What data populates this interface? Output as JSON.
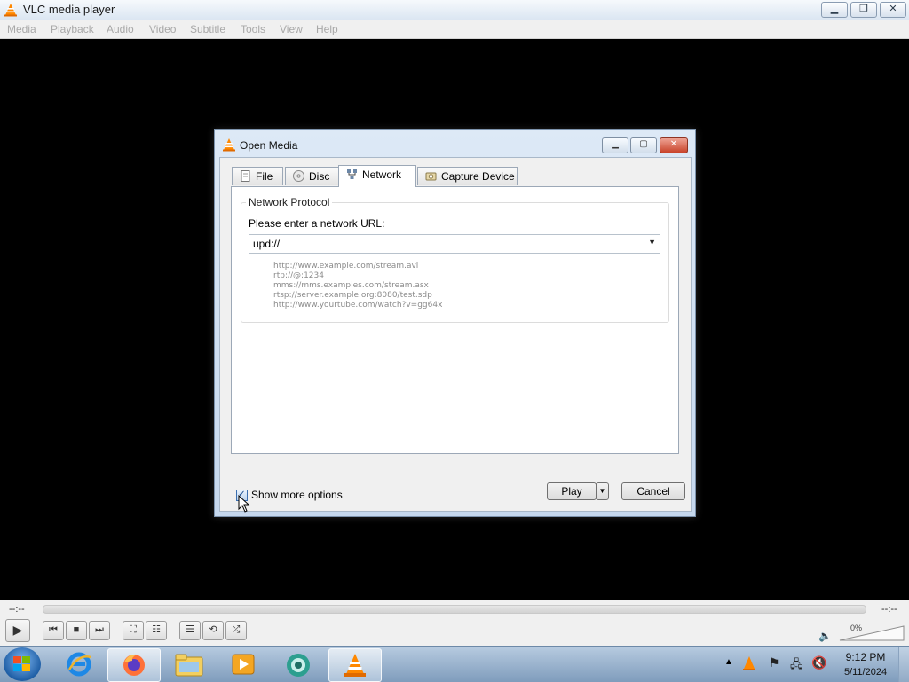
{
  "window": {
    "title": "VLC media player",
    "controls": [
      "minimize",
      "restore",
      "close"
    ]
  },
  "menubar": {
    "items": [
      "Media",
      "Playback",
      "Audio",
      "Video",
      "Subtitle",
      "Tools",
      "View",
      "Help"
    ]
  },
  "dialog": {
    "title": "Open Media",
    "tabs": [
      {
        "label": "File",
        "icon": "file-icon"
      },
      {
        "label": "Disc",
        "icon": "disc-icon"
      },
      {
        "label": "Network",
        "icon": "network-icon",
        "active": true
      },
      {
        "label": "Capture Device",
        "icon": "capture-device-icon"
      }
    ],
    "group_label": "Network Protocol",
    "url_prompt": "Please enter a network URL:",
    "url_value": "upd://",
    "examples": [
      "http://www.example.com/stream.avi",
      "rtp://@:1234",
      "mms://mms.examples.com/stream.asx",
      "rtsp://server.example.org:8080/test.sdp",
      "http://www.yourtube.com/watch?v=gg64x"
    ],
    "show_more_options": {
      "label": "Show more options",
      "checked": true
    },
    "play_label": "Play",
    "cancel_label": "Cancel"
  },
  "player": {
    "elapsed": "--:--",
    "remaining": "--:--",
    "volume": "0%",
    "buttons": [
      "play-icon",
      "previous-icon",
      "stop-icon",
      "next-icon",
      "fullscreen-icon",
      "extended-settings-icon",
      "playlist-icon",
      "loop-icon",
      "shuffle-icon"
    ]
  },
  "taskbar": {
    "apps": [
      "internet-explorer-icon",
      "firefox-icon",
      "file-explorer-icon",
      "media-player-icon",
      "app-icon",
      "vlc-icon"
    ],
    "clock_time": "9:12 PM",
    "clock_date": "5/11/2024"
  },
  "colors": {
    "accent": "#ff8800",
    "dialog_frame": "#c6d8ee",
    "close_button": "#c8432a"
  }
}
